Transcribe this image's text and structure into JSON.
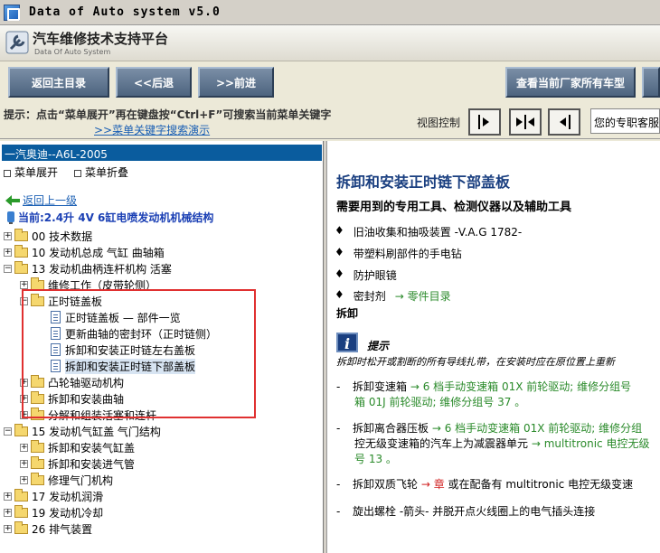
{
  "window": {
    "title": "Data of Auto system v5.0"
  },
  "header": {
    "brand": "汽车维修技术支持平台",
    "brand_sub": "Data Of Auto System"
  },
  "toolbar": {
    "main_menu": "返回主目录",
    "back": "<<后退",
    "forward": ">>前进",
    "all_models": "查看当前厂家所有车型"
  },
  "hint": {
    "text": "提示：点击“菜单展开”再在键盘按“Ctrl+F”可搜索当前菜单关键字",
    "link": ">>菜单关键字搜索演示",
    "view_label": "视图控制",
    "marquee": "您的专职客服"
  },
  "left": {
    "vehicle": "一汽奥迪--A6L-2005",
    "expand": "菜单展开",
    "collapse": "菜单折叠",
    "back_link": "返回上一级",
    "current": "当前:2.4升 4V 6缸电喷发动机机械结构",
    "tree": [
      {
        "label": "00 技术数据"
      },
      {
        "label": "10 发动机总成 气缸 曲轴箱"
      },
      {
        "label": "13 发动机曲柄连杆机构 活塞"
      },
      {
        "label": "维修工作（皮带轮侧）"
      },
      {
        "label": "正时链盖板"
      },
      {
        "label": "正时链盖板 — 部件一览"
      },
      {
        "label": "更新曲轴的密封环（正时链侧）"
      },
      {
        "label": "拆卸和安装正时链左右盖板"
      },
      {
        "label": "拆卸和安装正时链下部盖板"
      },
      {
        "label": "凸轮轴驱动机构"
      },
      {
        "label": "拆卸和安装曲轴"
      },
      {
        "label": "分解和组装活塞和连杆"
      },
      {
        "label": "15 发动机气缸盖 气门结构"
      },
      {
        "label": "拆卸和安装气缸盖"
      },
      {
        "label": "拆卸和安装进气管"
      },
      {
        "label": "修理气门机构"
      },
      {
        "label": "17 发动机润滑"
      },
      {
        "label": "19 发动机冷却"
      },
      {
        "label": "26 排气装置"
      }
    ]
  },
  "right": {
    "title": "拆卸和安装正时链下部盖板",
    "tools_heading": "需要用到的专用工具、检测仪器以及辅助工具",
    "tools": [
      {
        "text": "旧油收集和抽吸装置 -V.A.G 1782-",
        "link": ""
      },
      {
        "text": "带塑料刷部件的手电钻",
        "link": ""
      },
      {
        "text": "防护眼镜",
        "link": ""
      },
      {
        "text": "密封剂",
        "link": "→ 零件目录"
      }
    ],
    "section": "拆卸",
    "note_title": "提示",
    "note_text": "拆卸时松开或割断的所有导线扎带，在安装时应在原位置上重新",
    "steps": [
      {
        "line1_a": "拆卸变速箱",
        "line1_link": "→ 6 档手动变速箱 01X 前轮驱动; 维修分组号",
        "line2": "箱 01J 前轮驱动; 维修分组号 37 。"
      },
      {
        "line1_a": "拆卸离合器压板",
        "line1_link": "→ 6 档手动变速箱 01X 前轮驱动; 维修分组",
        "line2a": "控无级变速箱的汽车上为减震器单元",
        "line2_link": "→ multitronic 电控无级",
        "line3": "号 13 。"
      },
      {
        "line1_a": "拆卸双质飞轮",
        "line1_red": "→ 章",
        "line1_b": "或在配备有 multitronic 电控无级变速"
      },
      {
        "line1_a": "旋出螺栓 -箭头- 并脱开点火线圈上的电气插头连接"
      }
    ]
  }
}
